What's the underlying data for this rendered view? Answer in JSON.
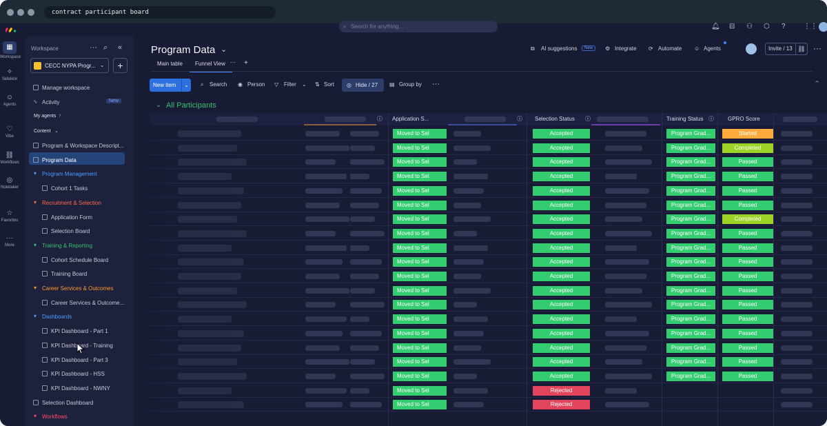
{
  "browser": {
    "address": "contract participant board"
  },
  "topbar": {
    "search_placeholder": "Search for anything..."
  },
  "rail": {
    "items": [
      "Workspace",
      "Sidekick",
      "Agents",
      "Vibe",
      "Workflows",
      "Notetaker",
      "Favorites",
      "More"
    ]
  },
  "sidebar": {
    "heading": "Workspace",
    "workspace_name": "CECC NYPA Progr...",
    "manage": "Manage workspace",
    "activity": "Activity",
    "activity_badge": "New",
    "my_agents": "My agents",
    "content": "Content",
    "items": [
      {
        "label": "Program & Workspace Descript...",
        "kind": "doc"
      },
      {
        "label": "Program Data",
        "kind": "board",
        "active": true
      },
      {
        "label": "Program Management",
        "kind": "folder",
        "color": "#4f9dff"
      },
      {
        "label": "Cohort 1 Tasks",
        "kind": "board"
      },
      {
        "label": "Recruitment & Selection",
        "kind": "folder",
        "color": "#ff6a4d"
      },
      {
        "label": "Application Form",
        "kind": "form"
      },
      {
        "label": "Selection Board",
        "kind": "board"
      },
      {
        "label": "Training & Reporting",
        "kind": "folder",
        "color": "#37c16f"
      },
      {
        "label": "Cohort Schedule Board",
        "kind": "board"
      },
      {
        "label": "Training Board",
        "kind": "board"
      },
      {
        "label": "Career Services & Outcomes",
        "kind": "folder",
        "color": "#ff9a2e"
      },
      {
        "label": "Career Services & Outcome...",
        "kind": "board"
      },
      {
        "label": "Dashboards",
        "kind": "folder",
        "color": "#4f9dff"
      },
      {
        "label": "KPI Dashboard - Part 1",
        "kind": "dash"
      },
      {
        "label": "KPI Dashboard - Training",
        "kind": "dash"
      },
      {
        "label": "KPI Dashboard - Part 3",
        "kind": "dash"
      },
      {
        "label": "KPI Dashboard - HSS",
        "kind": "dash"
      },
      {
        "label": "KPI Dashboard - NWNY",
        "kind": "dash"
      },
      {
        "label": "Selection Dashboard",
        "kind": "dash"
      },
      {
        "label": "Workflows",
        "kind": "folder",
        "color": "#ff4d6a"
      }
    ]
  },
  "header": {
    "title": "Program Data",
    "ai_suggestions": "AI suggestions",
    "ai_badge": "New",
    "integrate": "Integrate",
    "automate": "Automate",
    "agents": "Agents",
    "invite": "Invite / 13",
    "tabs": [
      "Main table",
      "Funnel View"
    ]
  },
  "toolbar": {
    "new_item": "New item",
    "search": "Search",
    "person": "Person",
    "filter": "Filter",
    "sort": "Sort",
    "hide": "Hide / 27",
    "group_by": "Group by"
  },
  "group": {
    "title": "All Participants"
  },
  "columns": {
    "application": "Application S...",
    "selection": "Selection Status",
    "training": "Training Status",
    "gpro": "GPRO Score"
  },
  "rows": [
    {
      "app": "Moved to Sel",
      "sel": "Accepted",
      "train": "Program Grad...",
      "gpro": "Started"
    },
    {
      "app": "Moved to Sel",
      "sel": "Accepted",
      "train": "Program Grad...",
      "gpro": "Completed"
    },
    {
      "app": "Moved to Sel",
      "sel": "Accepted",
      "train": "Program Grad...",
      "gpro": "Passed"
    },
    {
      "app": "Moved to Sel",
      "sel": "Accepted",
      "train": "Program Grad...",
      "gpro": "Passed"
    },
    {
      "app": "Moved to Sel",
      "sel": "Accepted",
      "train": "Program Grad...",
      "gpro": "Passed"
    },
    {
      "app": "Moved to Sel",
      "sel": "Accepted",
      "train": "Program Grad...",
      "gpro": "Passed"
    },
    {
      "app": "Moved to Sel",
      "sel": "Accepted",
      "train": "Program Grad...",
      "gpro": "Completed"
    },
    {
      "app": "Moved to Sel",
      "sel": "Accepted",
      "train": "Program Grad...",
      "gpro": "Passed"
    },
    {
      "app": "Moved to Sel",
      "sel": "Accepted",
      "train": "Program Grad...",
      "gpro": "Passed"
    },
    {
      "app": "Moved to Sel",
      "sel": "Accepted",
      "train": "Program Grad...",
      "gpro": "Passed"
    },
    {
      "app": "Moved to Sel",
      "sel": "Accepted",
      "train": "Program Grad...",
      "gpro": "Passed"
    },
    {
      "app": "Moved to Sel",
      "sel": "Accepted",
      "train": "Program Grad...",
      "gpro": "Passed"
    },
    {
      "app": "Moved to Sel",
      "sel": "Accepted",
      "train": "Program Grad...",
      "gpro": "Passed"
    },
    {
      "app": "Moved to Sel",
      "sel": "Accepted",
      "train": "Program Grad...",
      "gpro": "Passed"
    },
    {
      "app": "Moved to Sel",
      "sel": "Accepted",
      "train": "Program Grad...",
      "gpro": "Passed"
    },
    {
      "app": "Moved to Sel",
      "sel": "Accepted",
      "train": "Program Grad...",
      "gpro": "Passed"
    },
    {
      "app": "Moved to Sel",
      "sel": "Accepted",
      "train": "Program Grad...",
      "gpro": "Passed"
    },
    {
      "app": "Moved to Sel",
      "sel": "Accepted",
      "train": "Program Grad...",
      "gpro": "Passed"
    },
    {
      "app": "Moved to Sel",
      "sel": "Rejected",
      "train": "",
      "gpro": ""
    },
    {
      "app": "Moved to Sel",
      "sel": "Rejected",
      "train": "",
      "gpro": ""
    }
  ],
  "colors": {
    "accepted": "#33cc70",
    "rejected": "#e2445c",
    "program_grad": "#33cc70",
    "started": "#fdab3d",
    "completed": "#9cd326",
    "passed": "#33cc70",
    "primary": "#2e6fdf"
  }
}
